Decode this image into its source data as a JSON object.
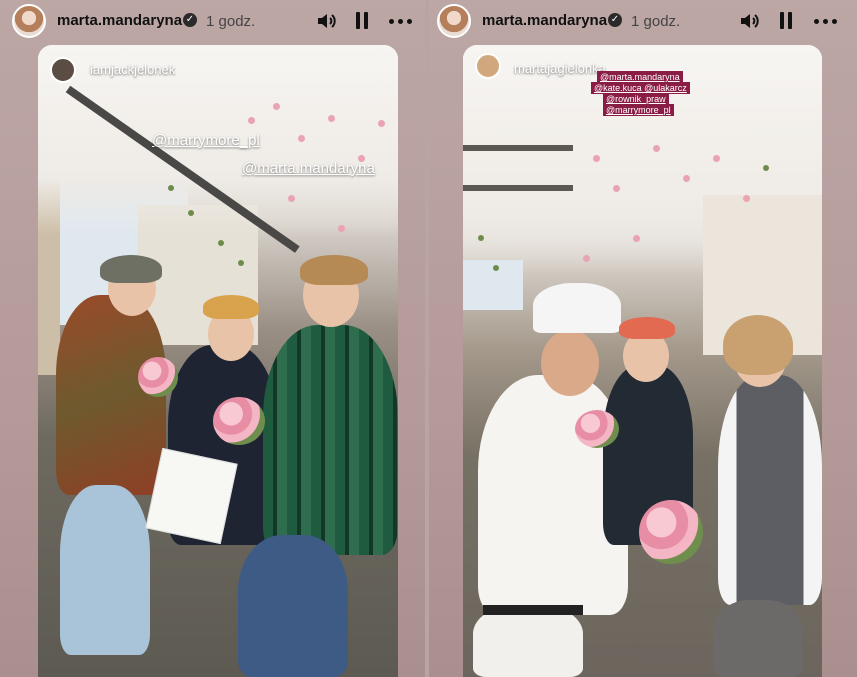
{
  "left_story": {
    "username": "marta.mandaryna",
    "time_ago": "1 godz.",
    "mention_user": "iamjackjelonek",
    "tags": [
      "@marrymore_pl",
      "@marta.mandaryna"
    ]
  },
  "right_story": {
    "username": "marta.mandaryna",
    "time_ago": "1 godz.",
    "mention_user": "martajagielonka",
    "tags": [
      "@marta.mandaryna",
      "@kate.kuca @ulakarcz",
      "@rownik_praw",
      "@marrymore_pl"
    ]
  },
  "icons": {
    "verified": "verified-icon",
    "mute": "volume-icon",
    "pause": "pause-icon",
    "more": "more-dots-icon"
  },
  "colors": {
    "background": "#b49a99",
    "tag_box": "#8a1d45",
    "text": "#111111"
  }
}
